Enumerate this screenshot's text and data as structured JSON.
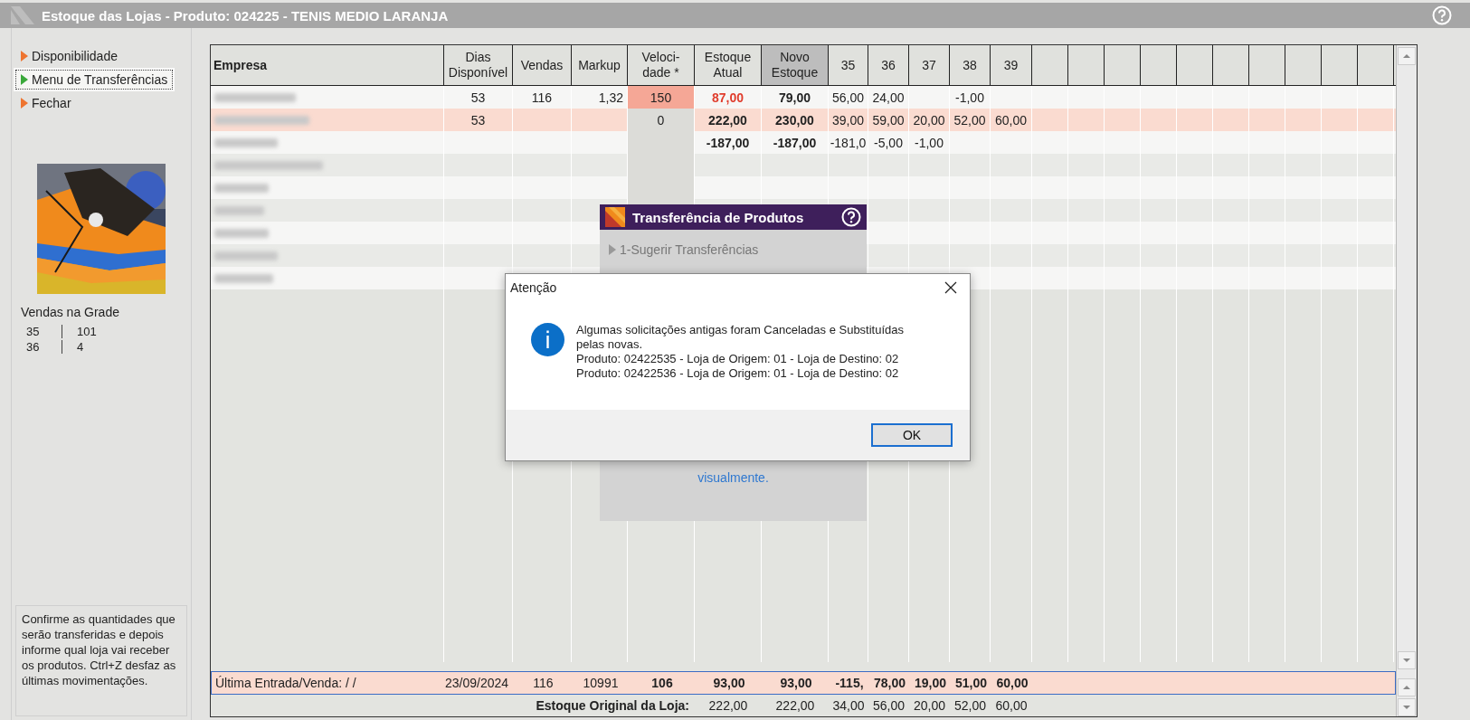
{
  "window": {
    "title": "Estoque das Lojas - Produto: 024225 - TENIS MEDIO LARANJA"
  },
  "sidebar": {
    "items": [
      {
        "label": "Disponibilidade",
        "selected": false
      },
      {
        "label": "Menu de Transferências",
        "selected": true
      },
      {
        "label": "Fechar",
        "selected": false
      }
    ],
    "sales_grid": {
      "title": "Vendas na Grade",
      "rows": [
        [
          "35",
          "101"
        ],
        [
          "36",
          "4"
        ]
      ]
    },
    "hint": "Confirme as quantidades que serão transferidas e depois informe qual loja vai receber os produtos. Ctrl+Z desfaz as últimas movimentações."
  },
  "table": {
    "columns": [
      {
        "label": "Empresa",
        "selected": false
      },
      {
        "label": "Dias\nDisponível",
        "selected": false
      },
      {
        "label": "Vendas",
        "selected": false
      },
      {
        "label": "Markup",
        "selected": false
      },
      {
        "label": "Veloci-\ndade *",
        "selected": false
      },
      {
        "label": "Estoque\nAtual",
        "selected": false
      },
      {
        "label": "Novo\nEstoque",
        "selected": true
      },
      {
        "label": "35",
        "selected": false
      },
      {
        "label": "36",
        "selected": false
      },
      {
        "label": "37",
        "selected": false
      },
      {
        "label": "38",
        "selected": false
      },
      {
        "label": "39",
        "selected": false
      }
    ],
    "rows": [
      {
        "highlighted": false,
        "velocity_alert": true,
        "stock_alert": true,
        "cells": [
          null,
          "53",
          "116",
          "1,32",
          "150",
          "87,00",
          "79,00",
          "56,00",
          "24,00",
          null,
          "-1,00",
          null
        ]
      },
      {
        "highlighted": true,
        "velocity_alert": false,
        "stock_alert": false,
        "cells": [
          null,
          "53",
          null,
          null,
          "0",
          "222,00",
          "230,00",
          "39,00",
          "59,00",
          "20,00",
          "52,00",
          "60,00"
        ]
      },
      {
        "highlighted": false,
        "stock_alert": false,
        "cells": [
          null,
          null,
          null,
          null,
          null,
          "-187,00",
          "-187,00",
          "-181,0",
          "-5,00",
          "-1,00",
          null,
          null
        ]
      },
      {
        "highlighted": false,
        "cells": [
          null,
          null,
          null,
          null,
          null,
          null,
          null,
          null,
          null,
          null,
          null,
          null
        ]
      },
      {
        "highlighted": false,
        "cells": [
          null,
          null,
          null,
          null,
          null,
          null,
          null,
          null,
          null,
          null,
          null,
          null
        ]
      },
      {
        "highlighted": false,
        "cells": [
          null,
          null,
          null,
          null,
          null,
          null,
          null,
          null,
          null,
          null,
          null,
          null
        ]
      },
      {
        "highlighted": false,
        "cells": [
          null,
          null,
          null,
          null,
          null,
          null,
          null,
          null,
          null,
          null,
          null,
          null
        ]
      },
      {
        "highlighted": false,
        "cells": [
          null,
          null,
          null,
          null,
          null,
          null,
          null,
          null,
          null,
          null,
          null,
          null
        ]
      },
      {
        "highlighted": false,
        "cells": [
          null,
          null,
          null,
          null,
          null,
          null,
          null,
          null,
          null,
          null,
          null,
          null
        ]
      }
    ],
    "summary": {
      "label": "Última Entrada/Venda:  / /",
      "cells": [
        "23/09/2024",
        "116",
        "10991",
        "106",
        "93,00",
        "93,00",
        "-115,",
        "78,00",
        "19,00",
        "51,00",
        "60,00"
      ]
    },
    "original_stock": {
      "label": "Estoque Original da Loja:",
      "cells": [
        "222,00",
        "222,00",
        "34,00",
        "56,00",
        "20,00",
        "52,00",
        "60,00"
      ]
    }
  },
  "transfer_panel": {
    "title": "Transferência de Produtos",
    "items": [
      "1-Sugerir Transferências"
    ],
    "footer_text": "visualmente."
  },
  "dialog": {
    "title": "Atenção",
    "message": [
      "Algumas solicitações antigas foram Canceladas e Substituídas pelas novas.",
      "Produto: 02422535 - Loja de Origem: 01 - Loja de Destino: 02",
      "Produto: 02422536 - Loja de Origem: 01 - Loja de Destino: 02"
    ],
    "buttons": [
      "OK"
    ]
  }
}
